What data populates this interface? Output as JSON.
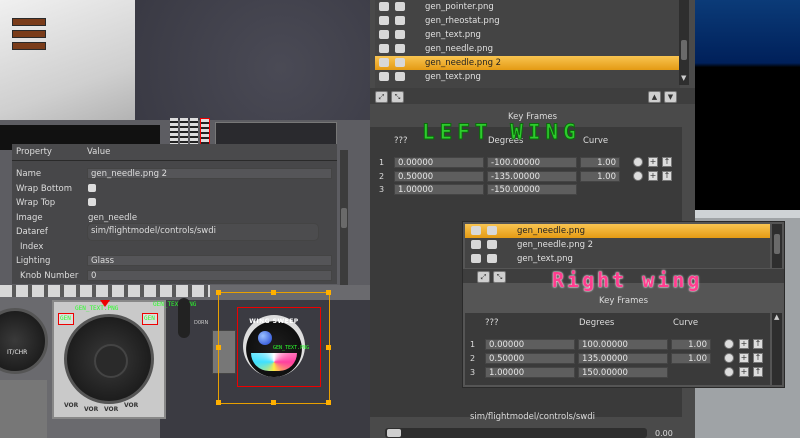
{
  "colors": {
    "accent_selected": "#f0ad2c",
    "dataref_outline": "#d01010",
    "overlay_left": "#2dcc2d",
    "overlay_right": "#ff3e8f",
    "green_text": "#2cff2c"
  },
  "overlays": {
    "left": "LEFT WING",
    "right": "Right wing"
  },
  "properties": {
    "header_property": "Property",
    "header_value": "Value",
    "rows": [
      {
        "label": "Name",
        "value": "gen_needle.png 2"
      },
      {
        "label": "Wrap Bottom",
        "value": ""
      },
      {
        "label": "Wrap Top",
        "value": ""
      },
      {
        "label": "Image",
        "value": "gen_needle"
      },
      {
        "label": "Dataref",
        "value": "sim/flightmodel/controls/swdi"
      },
      {
        "label": "Index",
        "value": ""
      },
      {
        "label": "Lighting",
        "value": "Glass"
      },
      {
        "label": "Knob Number",
        "value": "0"
      }
    ]
  },
  "scene": {
    "gen_text_label": "GEN_TEXT.PNG",
    "gen_label_small": "GEN",
    "gauge_labels": [
      "VOR",
      "VOR",
      "VOR",
      "VOR"
    ],
    "wing_title": "WING SWEEP",
    "altimeter_label": "IT/CHR",
    "misc_label": "D0RN"
  },
  "left_layer_list": {
    "items": [
      {
        "name": "gen_pointer.png",
        "selected": false
      },
      {
        "name": "gen_rheostat.png",
        "selected": false
      },
      {
        "name": "gen_text.png",
        "selected": false
      },
      {
        "name": "gen_needle.png",
        "selected": false
      },
      {
        "name": "gen_needle.png 2",
        "selected": true
      },
      {
        "name": "gen_text.png",
        "selected": false
      }
    ]
  },
  "left_keyframes": {
    "title": "Key Frames",
    "columns": [
      "???",
      "Degrees",
      "Curve"
    ],
    "rows": [
      {
        "index": "1",
        "value": "0.00000",
        "degrees": "-100.00000",
        "curve": "1.00"
      },
      {
        "index": "2",
        "value": "0.50000",
        "degrees": "-135.00000",
        "curve": "1.00"
      },
      {
        "index": "3",
        "value": "1.00000",
        "degrees": "-150.00000",
        "curve": ""
      }
    ]
  },
  "right_layer_list": {
    "items": [
      {
        "name": "gen_needle.png",
        "selected": true
      },
      {
        "name": "gen_needle.png 2",
        "selected": false
      },
      {
        "name": "gen_text.png",
        "selected": false
      }
    ]
  },
  "right_keyframes": {
    "title": "Key Frames",
    "columns": [
      "???",
      "Degrees",
      "Curve"
    ],
    "rows": [
      {
        "index": "1",
        "value": "0.00000",
        "degrees": "100.00000",
        "curve": "1.00"
      },
      {
        "index": "2",
        "value": "0.50000",
        "degrees": "135.00000",
        "curve": "1.00"
      },
      {
        "index": "3",
        "value": "1.00000",
        "degrees": "150.00000",
        "curve": ""
      }
    ]
  },
  "footer": {
    "dataref": "sim/flightmodel/controls/swdi",
    "slider_value": "0.00"
  }
}
